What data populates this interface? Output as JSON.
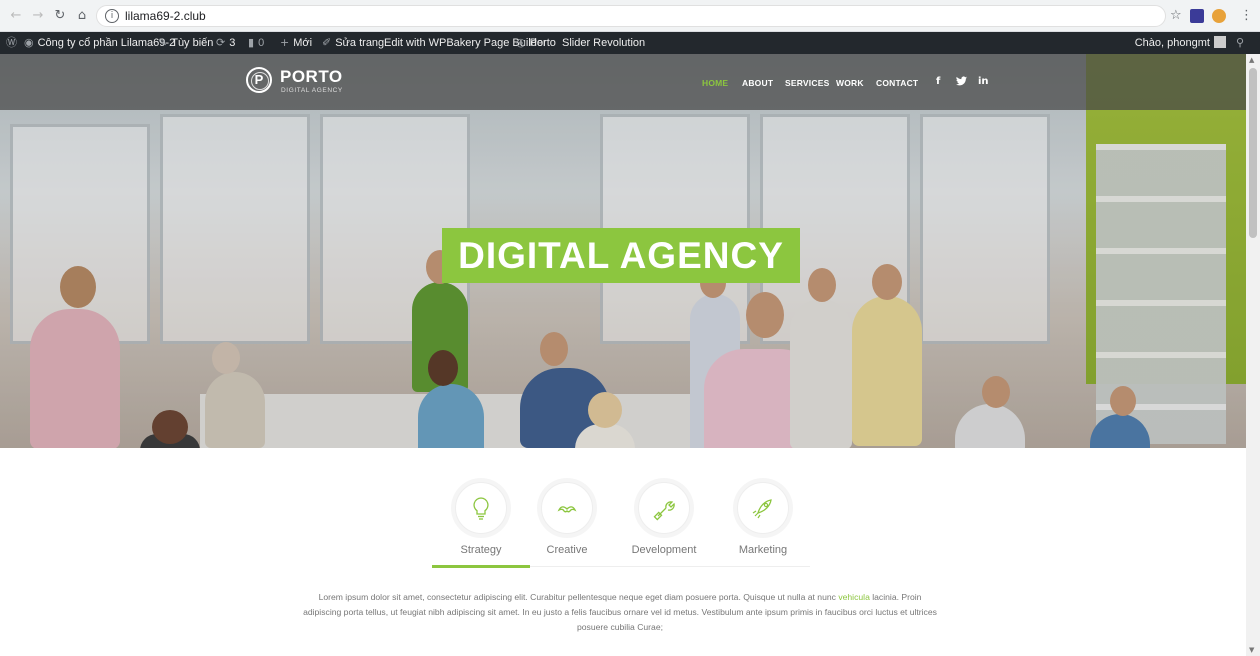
{
  "browser": {
    "url": "lilama69-2.club",
    "icons": {
      "back": "back-arrow-icon",
      "forward": "forward-arrow-icon",
      "reload": "reload-icon",
      "home": "home-icon",
      "info": "info-icon",
      "star": "star-icon",
      "menu": "kebab-menu-icon"
    }
  },
  "adminbar": {
    "site_name": "Công ty cổ phần Lilama69-2",
    "customize": "Tùy biến",
    "updates_count": "3",
    "comments_count": "0",
    "new": "Mới",
    "edit_page": "Sửa trang",
    "wpbakery": "Edit with WPBakery Page Builder",
    "porto": "Porto",
    "slider": "Slider Revolution",
    "greeting": "Chào, phongmt"
  },
  "header": {
    "logo_letter": "P",
    "logo_title": "PORTO",
    "logo_subtitle": "DIGITAL AGENCY",
    "menu": [
      {
        "label": "HOME",
        "active": true
      },
      {
        "label": "ABOUT",
        "active": false
      },
      {
        "label": "SERVICES",
        "active": false
      },
      {
        "label": "WORK",
        "active": false
      },
      {
        "label": "CONTACT",
        "active": false
      }
    ],
    "social": [
      "f",
      "t",
      "in"
    ]
  },
  "hero": {
    "title": "DIGITAL AGENCY",
    "accent_color": "#8cc63f"
  },
  "services": {
    "tabs": [
      {
        "label": "Strategy",
        "icon": "lightbulb-icon",
        "active": true
      },
      {
        "label": "Creative",
        "icon": "mustache-icon",
        "active": false
      },
      {
        "label": "Development",
        "icon": "wrench-icon",
        "active": false
      },
      {
        "label": "Marketing",
        "icon": "rocket-icon",
        "active": false
      }
    ]
  },
  "content": {
    "para_before": "Lorem ipsum dolor sit amet, consectetur adipiscing elit. Curabitur pellentesque neque eget diam posuere porta. Quisque ut nulla at nunc",
    "para_link": "vehicula",
    "para_after": "lacinia. Proin adipiscing porta tellus, ut feugiat nibh adipiscing sit amet. In eu justo a felis faucibus ornare vel id metus. Vestibulum ante ipsum primis in faucibus orci luctus et ultrices posuere cubilia Curae;"
  }
}
